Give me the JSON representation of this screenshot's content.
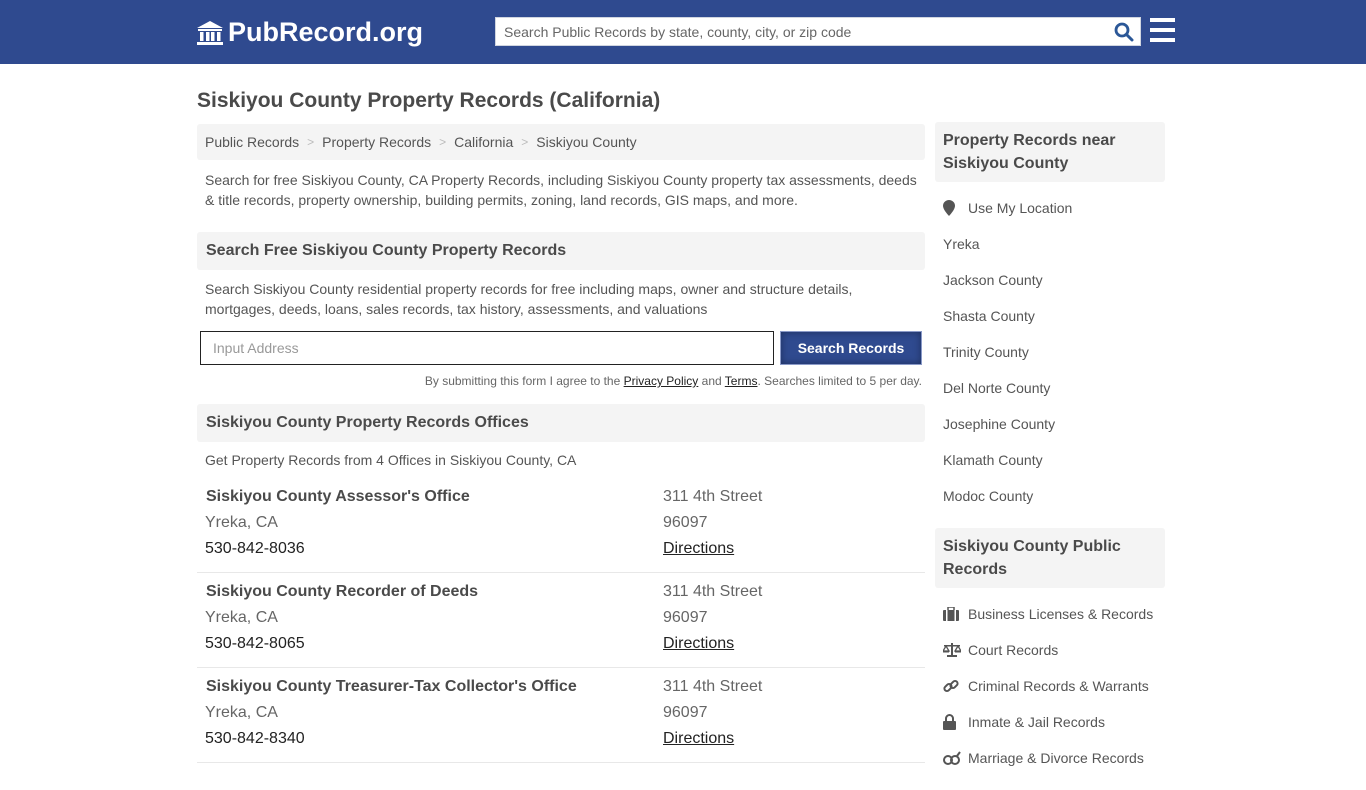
{
  "header": {
    "logo_text": "PubRecord.org",
    "search_placeholder": "Search Public Records by state, county, city, or zip code",
    "brand_color": "#2f4a8f"
  },
  "page_title": "Siskiyou County Property Records (California)",
  "breadcrumb": [
    "Public Records",
    "Property Records",
    "California",
    "Siskiyou County"
  ],
  "intro": "Search for free Siskiyou County, CA Property Records, including Siskiyou County property tax assessments, deeds & title records, property ownership, building permits, zoning, land records, GIS maps, and more.",
  "search_section": {
    "heading": "Search Free Siskiyou County Property Records",
    "description": "Search Siskiyou County residential property records for free including maps, owner and structure details, mortgages, deeds, loans, sales records, tax history, assessments, and valuations",
    "input_placeholder": "Input Address",
    "button_label": "Search Records",
    "disclaimer_pre": "By submitting this form I agree to the ",
    "privacy_label": "Privacy Policy",
    "disclaimer_and": " and ",
    "terms_label": "Terms",
    "disclaimer_post": ". Searches limited to 5 per day."
  },
  "offices_section": {
    "heading": "Siskiyou County Property Records Offices",
    "description": "Get Property Records from 4 Offices in Siskiyou County, CA",
    "offices": [
      {
        "name": "Siskiyou County Assessor's Office",
        "city": "Yreka, CA",
        "phone": "530-842-8036",
        "street": "311 4th Street",
        "zip": "96097",
        "directions": "Directions"
      },
      {
        "name": "Siskiyou County Recorder of Deeds",
        "city": "Yreka, CA",
        "phone": "530-842-8065",
        "street": "311 4th Street",
        "zip": "96097",
        "directions": "Directions"
      },
      {
        "name": "Siskiyou County Treasurer-Tax Collector's Office",
        "city": "Yreka, CA",
        "phone": "530-842-8340",
        "street": "311 4th Street",
        "zip": "96097",
        "directions": "Directions"
      }
    ]
  },
  "sidebar": {
    "nearby_heading": "Property Records near Siskiyou County",
    "use_location": "Use My Location",
    "nearby": [
      "Yreka",
      "Jackson County",
      "Shasta County",
      "Trinity County",
      "Del Norte County",
      "Josephine County",
      "Klamath County",
      "Modoc County"
    ],
    "public_heading": "Siskiyou County Public Records",
    "public_records": [
      {
        "label": "Business Licenses & Records",
        "icon": "briefcase-icon"
      },
      {
        "label": "Court Records",
        "icon": "balance-scale-icon"
      },
      {
        "label": "Criminal Records & Warrants",
        "icon": "link-icon"
      },
      {
        "label": "Inmate & Jail Records",
        "icon": "lock-icon"
      },
      {
        "label": "Marriage & Divorce Records",
        "icon": "marriage-icon"
      }
    ]
  }
}
